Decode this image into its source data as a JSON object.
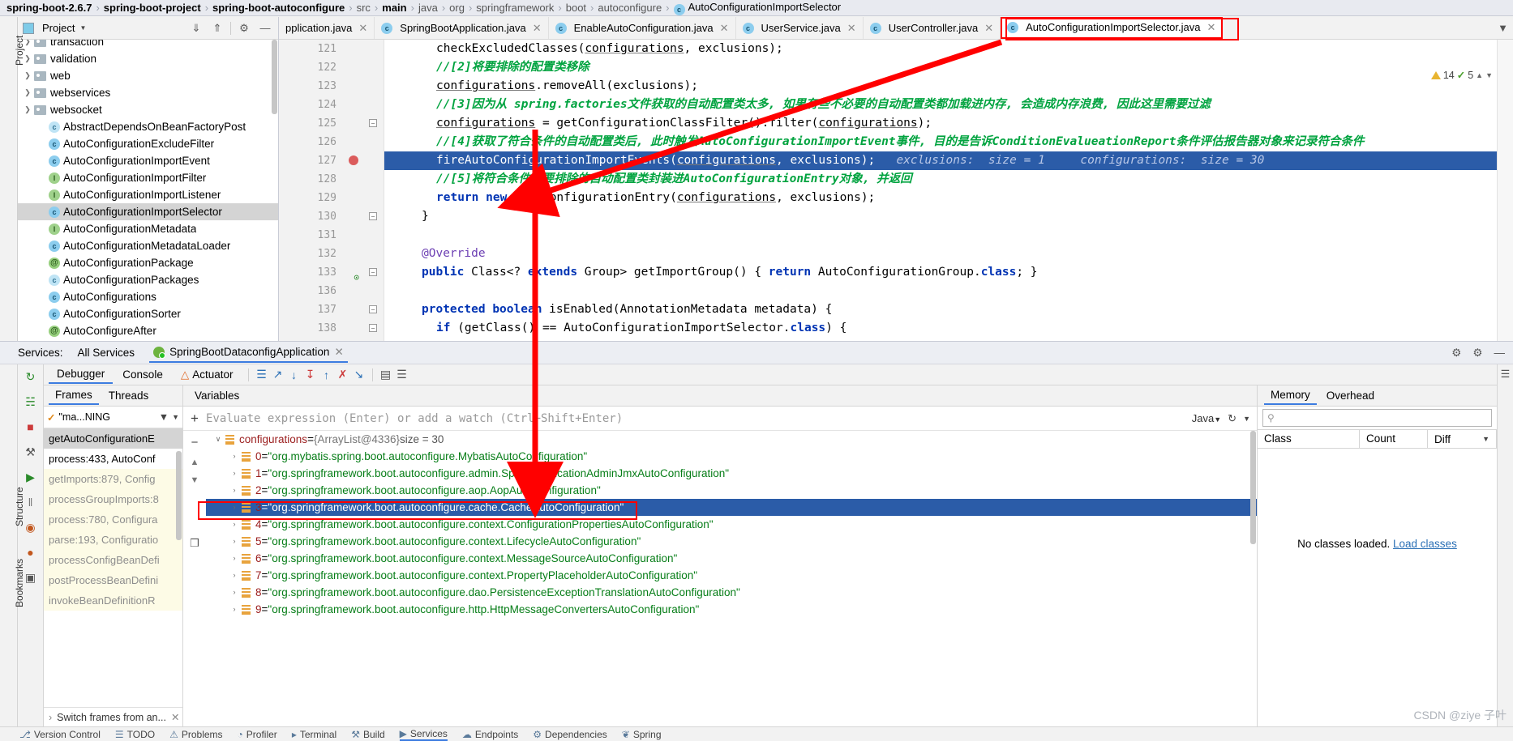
{
  "breadcrumb": {
    "items": [
      {
        "label": "spring-boot-2.6.7",
        "style": "bold"
      },
      {
        "label": "spring-boot-project",
        "style": "bold"
      },
      {
        "label": "spring-boot-autoconfigure",
        "style": "bold"
      },
      {
        "label": "src",
        "style": "dim"
      },
      {
        "label": "main",
        "style": "bold"
      },
      {
        "label": "java",
        "style": "dim"
      },
      {
        "label": "org",
        "style": "dim"
      },
      {
        "label": "springframework",
        "style": "dim"
      },
      {
        "label": "boot",
        "style": "dim"
      },
      {
        "label": "autoconfigure",
        "style": "dim"
      },
      {
        "label": "AutoConfigurationImportSelector",
        "style": "class"
      }
    ],
    "separator": "›"
  },
  "left_strip": {
    "label": "Project"
  },
  "project_panel": {
    "title": "Project",
    "dropdown_icon": "chevron-down-icon",
    "toolbar": [
      {
        "name": "expand-all-icon",
        "glyph": "⤓"
      },
      {
        "name": "collapse-all-icon",
        "glyph": "⤒"
      },
      {
        "name": "settings-gear-icon",
        "glyph": "⚙"
      },
      {
        "name": "hide-panel-icon",
        "glyph": "—"
      }
    ],
    "tree": [
      {
        "label": "transaction",
        "type": "folder",
        "arrow": true,
        "clipped": true
      },
      {
        "label": "validation",
        "type": "folder",
        "arrow": true
      },
      {
        "label": "web",
        "type": "folder",
        "arrow": true
      },
      {
        "label": "webservices",
        "type": "folder",
        "arrow": true
      },
      {
        "label": "websocket",
        "type": "folder",
        "arrow": true
      },
      {
        "label": "AbstractDependsOnBeanFactoryPost",
        "type": "abstract-class"
      },
      {
        "label": "AutoConfigurationExcludeFilter",
        "type": "class"
      },
      {
        "label": "AutoConfigurationImportEvent",
        "type": "class"
      },
      {
        "label": "AutoConfigurationImportFilter",
        "type": "interface"
      },
      {
        "label": "AutoConfigurationImportListener",
        "type": "interface"
      },
      {
        "label": "AutoConfigurationImportSelector",
        "type": "class",
        "selected": true
      },
      {
        "label": "AutoConfigurationMetadata",
        "type": "interface"
      },
      {
        "label": "AutoConfigurationMetadataLoader",
        "type": "class"
      },
      {
        "label": "AutoConfigurationPackage",
        "type": "annotation"
      },
      {
        "label": "AutoConfigurationPackages",
        "type": "abstract-class"
      },
      {
        "label": "AutoConfigurations",
        "type": "class"
      },
      {
        "label": "AutoConfigurationSorter",
        "type": "class"
      },
      {
        "label": "AutoConfigureAfter",
        "type": "annotation"
      }
    ]
  },
  "editor": {
    "tabs": [
      {
        "label": "pplication.java",
        "icon": "java-class-icon",
        "clipped": true
      },
      {
        "label": "SpringBootApplication.java",
        "icon": "java-class-icon"
      },
      {
        "label": "EnableAutoConfiguration.java",
        "icon": "java-class-icon"
      },
      {
        "label": "UserService.java",
        "icon": "java-class-icon"
      },
      {
        "label": "UserController.java",
        "icon": "java-class-icon"
      },
      {
        "label": "AutoConfigurationImportSelector.java",
        "icon": "java-class-icon",
        "active": true,
        "highlighted": true
      }
    ],
    "tab_overflow_icon": "chevron-down-icon",
    "inspection_status": {
      "warnings": "14",
      "weak_warnings": "5",
      "warning_icon": "warning-triangle-icon",
      "ok_icon": "check-icon"
    },
    "lines": [
      {
        "num": "121",
        "indent": 4,
        "segments": [
          {
            "t": "checkExcludedClasses(",
            "c": "plain"
          },
          {
            "t": "configurations",
            "c": "ident"
          },
          {
            "t": ", exclusions);",
            "c": "plain"
          }
        ]
      },
      {
        "num": "122",
        "indent": 4,
        "segments": [
          {
            "t": "//[2]将要排除的配置类移除",
            "c": "cmt"
          }
        ]
      },
      {
        "num": "123",
        "indent": 4,
        "segments": [
          {
            "t": "configurations",
            "c": "ident"
          },
          {
            "t": ".removeAll(exclusions);",
            "c": "plain"
          }
        ]
      },
      {
        "num": "124",
        "indent": 4,
        "segments": [
          {
            "t": "//[3]因为从 spring.factories文件获取的自动配置类太多, 如果有些不必要的自动配置类都加载进内存, 会造成内存浪费, 因此这里需要过滤",
            "c": "cmt"
          }
        ]
      },
      {
        "num": "125",
        "indent": 4,
        "fold": true,
        "segments": [
          {
            "t": "configurations",
            "c": "ident"
          },
          {
            "t": " = getConfigurationClassFilter().filter(",
            "c": "plain"
          },
          {
            "t": "configurations",
            "c": "ident"
          },
          {
            "t": ");",
            "c": "plain"
          }
        ]
      },
      {
        "num": "126",
        "indent": 4,
        "segments": [
          {
            "t": "//[4]获取了符合条件的自动配置类后, 此时触发AutoConfigurationImportEvent事件, 目的是告诉ConditionEvalueationReport条件评估报告器对象来记录符合条件",
            "c": "cmt"
          }
        ]
      },
      {
        "num": "127",
        "indent": 4,
        "breakpoint": true,
        "highlight": true,
        "segments": [
          {
            "t": "fireAutoConfigurationImportEvents(",
            "c": "plain"
          },
          {
            "t": "configurations",
            "c": "ident"
          },
          {
            "t": ", exclusions);",
            "c": "plain"
          },
          {
            "t": "   exclusions:  size = 1     configurations:  size = 30",
            "c": "hint"
          }
        ]
      },
      {
        "num": "128",
        "indent": 4,
        "segments": [
          {
            "t": "//[5]将符合条件和要排除的自动配置类封装进AutoConfigurationEntry对象, 并返回",
            "c": "cmt"
          }
        ]
      },
      {
        "num": "129",
        "indent": 4,
        "segments": [
          {
            "t": "return",
            "c": "kw"
          },
          {
            "t": " ",
            "c": "plain"
          },
          {
            "t": "new",
            "c": "kw"
          },
          {
            "t": " AutoConfigurationEntry(",
            "c": "plain"
          },
          {
            "t": "configurations",
            "c": "ident"
          },
          {
            "t": ", exclusions);",
            "c": "plain"
          }
        ]
      },
      {
        "num": "130",
        "indent": 2,
        "fold": true,
        "segments": [
          {
            "t": "}",
            "c": "plain"
          }
        ]
      },
      {
        "num": "131",
        "indent": 2,
        "segments": []
      },
      {
        "num": "132",
        "indent": 2,
        "segments": [
          {
            "t": "@Override",
            "c": "anno"
          }
        ]
      },
      {
        "num": "133",
        "indent": 2,
        "fold": true,
        "gutterMark": "override",
        "segments": [
          {
            "t": "public",
            "c": "kw"
          },
          {
            "t": " Class<? ",
            "c": "plain"
          },
          {
            "t": "extends",
            "c": "kw"
          },
          {
            "t": " Group> getImportGroup() { ",
            "c": "plain"
          },
          {
            "t": "return",
            "c": "kw"
          },
          {
            "t": " AutoConfigurationGroup.",
            "c": "plain"
          },
          {
            "t": "class",
            "c": "kw"
          },
          {
            "t": "; }",
            "c": "plain"
          }
        ]
      },
      {
        "num": "136",
        "indent": 2,
        "segments": []
      },
      {
        "num": "137",
        "indent": 2,
        "fold": true,
        "segments": [
          {
            "t": "protected",
            "c": "kw"
          },
          {
            "t": " ",
            "c": "plain"
          },
          {
            "t": "boolean",
            "c": "kw"
          },
          {
            "t": " isEnabled(AnnotationMetadata metadata) {",
            "c": "plain"
          }
        ]
      },
      {
        "num": "138",
        "indent": 4,
        "fold": true,
        "segments": [
          {
            "t": "if",
            "c": "kw"
          },
          {
            "t": " (getClass() == AutoConfigurationImportSelector.",
            "c": "plain"
          },
          {
            "t": "class",
            "c": "kw"
          },
          {
            "t": ") {",
            "c": "plain"
          }
        ]
      }
    ]
  },
  "services": {
    "label": "Services:",
    "all_services": "All Services",
    "run_config": "SpringBootDataconfigApplication",
    "close_icon": "close-icon",
    "right_icons": [
      {
        "name": "settings-extra-icon",
        "glyph": "⊕"
      },
      {
        "name": "gear-icon",
        "glyph": "⚙"
      },
      {
        "name": "hide-icon",
        "glyph": "—"
      }
    ]
  },
  "debugger": {
    "side_tools": [
      {
        "name": "rerun-icon",
        "glyph": "↻"
      },
      {
        "name": "rerun-debug-icon",
        "glyph": "☵"
      },
      {
        "name": "stop-icon",
        "glyph": "■"
      },
      {
        "name": "settings-wrench-icon",
        "glyph": "⚒"
      },
      {
        "name": "resume-program-icon",
        "glyph": "▶"
      },
      {
        "name": "pause-program-icon",
        "glyph": "‖"
      },
      {
        "name": "mute-breakpoints-icon",
        "glyph": "◉"
      },
      {
        "name": "view-breakpoints-icon",
        "glyph": "●"
      },
      {
        "name": "camera-icon",
        "glyph": "▣"
      }
    ],
    "tabs": [
      {
        "label": "Debugger",
        "active": true
      },
      {
        "label": "Console",
        "active": false
      },
      {
        "label": "Actuator",
        "active": false,
        "icon": "actuator-icon"
      }
    ],
    "toolbar_icons": [
      {
        "name": "show-execution-point-icon",
        "glyph": "☰"
      },
      {
        "name": "step-over-icon",
        "glyph": "↗"
      },
      {
        "name": "step-into-icon",
        "glyph": "↓"
      },
      {
        "name": "force-step-into-icon",
        "glyph": "↧"
      },
      {
        "name": "step-out-icon",
        "glyph": "↑"
      },
      {
        "name": "drop-frame-icon",
        "glyph": "✗"
      },
      {
        "name": "run-to-cursor-icon",
        "glyph": "↘"
      },
      {
        "name": "evaluate-expression-icon",
        "glyph": "▤"
      },
      {
        "name": "settings-icon",
        "glyph": "☰"
      }
    ],
    "frames": {
      "tabs": [
        {
          "label": "Frames",
          "active": true
        },
        {
          "label": "Threads",
          "active": false
        }
      ],
      "thread_selector": "\"ma...NING",
      "thread_check_icon": "check-icon",
      "filter_icon": "filter-icon",
      "dropdown_icon": "chevron-down-icon",
      "items": [
        {
          "label": "getAutoConfigurationE",
          "selected": true,
          "lib": false
        },
        {
          "label": "process:433, AutoConf",
          "selected": false,
          "lib": false
        },
        {
          "label": "getImports:879, Config",
          "selected": false,
          "lib": true
        },
        {
          "label": "processGroupImports:8",
          "selected": false,
          "lib": true
        },
        {
          "label": "process:780, Configura",
          "selected": false,
          "lib": true
        },
        {
          "label": "parse:193, Configuratio",
          "selected": false,
          "lib": true
        },
        {
          "label": "processConfigBeanDefi",
          "selected": false,
          "lib": true
        },
        {
          "label": "postProcessBeanDefini",
          "selected": false,
          "lib": true
        },
        {
          "label": "invokeBeanDefinitionR",
          "selected": false,
          "lib": true
        }
      ],
      "footer": "Switch frames from an...",
      "footer_close_icon": "close-icon"
    },
    "variables": {
      "tab_label": "Variables",
      "eval_placeholder": "Evaluate expression (Enter) or add a watch (Ctrl+Shift+Enter)",
      "add_watch_icon": "plus-icon",
      "remove_watch_icon": "minus-icon",
      "language": "Java",
      "rows": [
        {
          "indent": 0,
          "arrow": "∨",
          "name": "configurations",
          "eq": " = ",
          "meta": "{ArrayList@4336}",
          "extra": " size = 30"
        },
        {
          "indent": 1,
          "arrow": "›",
          "name": "0",
          "eq": " = ",
          "value": "\"org.mybatis.spring.boot.autoconfigure.MybatisAutoConfiguration\""
        },
        {
          "indent": 1,
          "arrow": "›",
          "name": "1",
          "eq": " = ",
          "value": "\"org.springframework.boot.autoconfigure.admin.SpringApplicationAdminJmxAutoConfiguration\""
        },
        {
          "indent": 1,
          "arrow": "›",
          "name": "2",
          "eq": " = ",
          "value": "\"org.springframework.boot.autoconfigure.aop.AopAutoConfiguration\""
        },
        {
          "indent": 1,
          "arrow": "›",
          "name": "3",
          "eq": " = ",
          "value": "\"org.springframework.boot.autoconfigure.cache.CacheAutoConfiguration\"",
          "selected": true,
          "highlighted": true
        },
        {
          "indent": 1,
          "arrow": "›",
          "name": "4",
          "eq": " = ",
          "value": "\"org.springframework.boot.autoconfigure.context.ConfigurationPropertiesAutoConfiguration\""
        },
        {
          "indent": 1,
          "arrow": "›",
          "name": "5",
          "eq": " = ",
          "value": "\"org.springframework.boot.autoconfigure.context.LifecycleAutoConfiguration\""
        },
        {
          "indent": 1,
          "arrow": "›",
          "name": "6",
          "eq": " = ",
          "value": "\"org.springframework.boot.autoconfigure.context.MessageSourceAutoConfiguration\""
        },
        {
          "indent": 1,
          "arrow": "›",
          "name": "7",
          "eq": " = ",
          "value": "\"org.springframework.boot.autoconfigure.context.PropertyPlaceholderAutoConfiguration\""
        },
        {
          "indent": 1,
          "arrow": "›",
          "name": "8",
          "eq": " = ",
          "value": "\"org.springframework.boot.autoconfigure.dao.PersistenceExceptionTranslationAutoConfiguration\""
        },
        {
          "indent": 1,
          "arrow": "›",
          "name": "9",
          "eq": " = ",
          "value": "\"org.springframework.boot.autoconfigure.http.HttpMessageConvertersAutoConfiguration\""
        }
      ],
      "gutter_icons": [
        {
          "name": "copy-value-icon",
          "glyph": "❐"
        },
        {
          "name": "inspect-icon",
          "glyph": "◉"
        }
      ]
    },
    "memory": {
      "tabs": [
        {
          "label": "Memory",
          "active": true
        },
        {
          "label": "Overhead",
          "active": false
        }
      ],
      "search_icon": "search-icon",
      "search_placeholder": "",
      "columns": [
        "Class",
        "Count",
        "Diff"
      ],
      "column_menu_icon": "chevron-down-icon",
      "empty_text": "No classes loaded.",
      "load_link": "Load classes"
    }
  },
  "status_bar": {
    "items": [
      {
        "label": "Version Control",
        "icon": "vcs-icon"
      },
      {
        "label": "TODO",
        "icon": "todo-icon"
      },
      {
        "label": "Problems",
        "icon": "problems-icon"
      },
      {
        "label": "Profiler",
        "icon": "profiler-icon"
      },
      {
        "label": "Terminal",
        "icon": "terminal-icon"
      },
      {
        "label": "Build",
        "icon": "build-icon"
      },
      {
        "label": "Services",
        "icon": "services-icon",
        "active": true
      },
      {
        "label": "Endpoints",
        "icon": "endpoints-icon"
      },
      {
        "label": "Dependencies",
        "icon": "dependencies-icon"
      },
      {
        "label": "Spring",
        "icon": "spring-icon"
      }
    ]
  },
  "right_strips": {
    "bottom_icons": [
      {
        "name": "notifications-icon",
        "glyph": "☰"
      }
    ]
  },
  "left_bottom_strip": {
    "items": [
      {
        "label": "Structure"
      },
      {
        "label": "Bookmarks"
      }
    ]
  },
  "annotations": {
    "watermark": "CSDN @ziye 子叶",
    "arrow_color": "#ff0000",
    "boxes": [
      {
        "name": "editor-tab-highlight"
      },
      {
        "name": "variable-row-highlight"
      }
    ]
  }
}
